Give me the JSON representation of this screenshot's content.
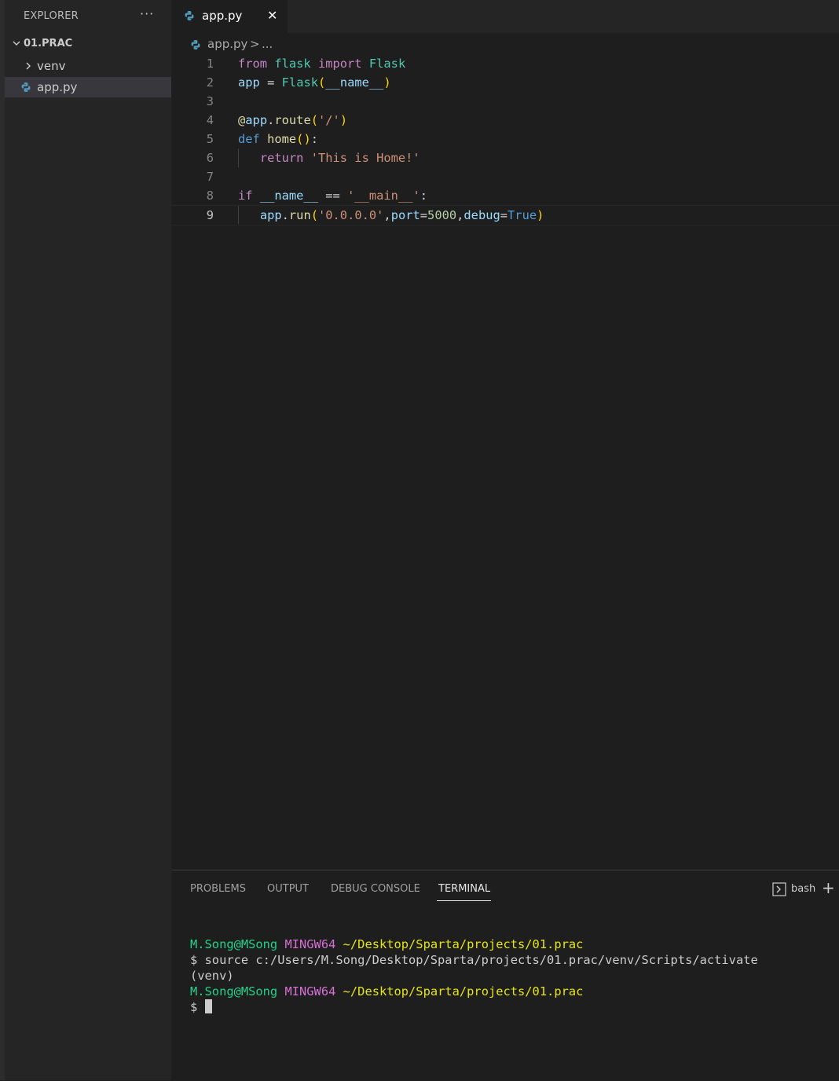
{
  "sidebar": {
    "title": "EXPLORER",
    "more": "···",
    "folder": "01.PRAC",
    "items": [
      {
        "label": "venv",
        "type": "folder"
      },
      {
        "label": "app.py",
        "type": "file"
      }
    ]
  },
  "editor": {
    "tab_label": "app.py",
    "close_glyph": "✕",
    "breadcrumb": {
      "file": "app.py",
      "separator": ">",
      "more": "..."
    },
    "line_numbers": [
      "1",
      "2",
      "3",
      "4",
      "5",
      "6",
      "7",
      "8",
      "9"
    ],
    "code": {
      "l1": {
        "kw_from": "from",
        "mod": "flask",
        "kw_import": "import",
        "cls": "Flask"
      },
      "l2": {
        "var": "app",
        "eq": "=",
        "cls": "Flask",
        "paren_open": "(",
        "arg": "__name__",
        "paren_close": ")"
      },
      "l4": {
        "at": "@",
        "var": "app",
        "dot": ".",
        "fn": "route",
        "paren_open": "(",
        "str": "'/'",
        "paren_close": ")"
      },
      "l5": {
        "kw": "def",
        "fn": "home",
        "parens": "()",
        "colon": ":"
      },
      "l6": {
        "kw": "return",
        "str": "'This is Home!'"
      },
      "l8": {
        "kw": "if",
        "var": "__name__",
        "op": "==",
        "str": "'__main__'",
        "colon": ":"
      },
      "l9": {
        "var": "app",
        "dot": ".",
        "fn": "run",
        "paren_open": "(",
        "str": "'0.0.0.0'",
        "comma1": ",",
        "p1": "port",
        "eq1": "=",
        "num": "5000",
        "comma2": ",",
        "p2": "debug",
        "eq2": "=",
        "kw": "True",
        "paren_close": ")"
      }
    }
  },
  "panel": {
    "tabs": [
      "PROBLEMS",
      "OUTPUT",
      "DEBUG CONSOLE",
      "TERMINAL"
    ],
    "active_tab": "TERMINAL",
    "terminal_name": "bash",
    "add": "+",
    "terminal": {
      "user": "M.Song@MSong",
      "host": "MINGW64",
      "path": "~/Desktop/Sparta/projects/01.prac",
      "command": "$ source c:/Users/M.Song/Desktop/Sparta/projects/01.prac/venv/Scripts/activate",
      "venv": "(venv)",
      "prompt": "$"
    }
  },
  "colors": {
    "background": "#1e1e1e",
    "sidebar": "#252526",
    "selected": "#37373d",
    "python_icon": "#519aba"
  }
}
